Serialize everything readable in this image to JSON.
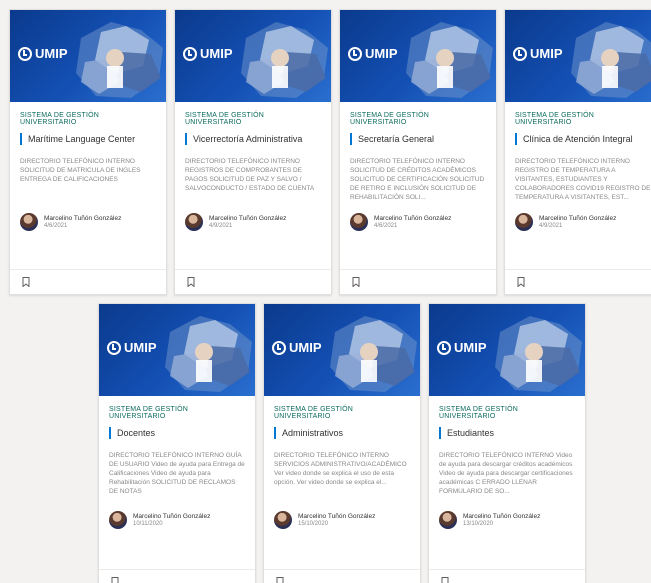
{
  "colors": {
    "banner": "#1450b4",
    "accent": "#0078d4",
    "section": "#0b6a5e",
    "page_bg": "#f3f2f1"
  },
  "icons": {
    "logo": "umip-logo-icon",
    "bookmark": "bookmark-icon",
    "avatar": "avatar-icon"
  },
  "cards": [
    {
      "logo": "UMIP",
      "section": "SISTEMA DE GESTIÓN UNIVERSITARIO",
      "title": "Marítime Language Center",
      "description": "DIRECTORIO TELEFÓNICO INTERNO SOLICITUD DE MATRICULA DE INGLES ENTREGA DE CALIFICACIONES",
      "author": "Marcelino Tuñón González",
      "date": "4/6/2021"
    },
    {
      "logo": "UMIP",
      "section": "SISTEMA DE GESTIÓN UNIVERSITARIO",
      "title": "Vicerrectoría Administrativa",
      "description": "DIRECTORIO TELEFÓNICO INTERNO REGISTROS DE COMPROBANTES DE PAGOS SOLICITUD DE PAZ Y SALVO / SALVOCONDUCTO / ESTADO DE CUENTA",
      "author": "Marcelino Tuñón González",
      "date": "4/9/2021"
    },
    {
      "logo": "UMIP",
      "section": "SISTEMA DE GESTIÓN UNIVERSITARIO",
      "title": "Secretaría General",
      "description": "DIRECTORIO TELEFÓNICO INTERNO SOLICITUD DE CRÉDITOS ACADÉMICOS SOLICITUD DE CERTIFICACIÓN SOLICITUD DE RETIRO E INCLUSIÓN SOLICITUD DE REHABILITACIÓN SOLI...",
      "author": "Marcelino Tuñón González",
      "date": "4/6/2021"
    },
    {
      "logo": "UMIP",
      "section": "SISTEMA DE GESTIÓN UNIVERSITARIO",
      "title": "Clínica de Atención Integral",
      "description": "DIRECTORIO TELEFÓNICO INTERNO REGISTRO DE TEMPERATURA A VISITANTES, ESTUDIANTES Y COLABORADORES COVID19 REGISTRO DE TEMPERATURA A VISITANTES, EST...",
      "author": "Marcelino Tuñón González",
      "date": "4/9/2021"
    },
    {
      "logo": "UMIP",
      "section": "SISTEMA DE GESTIÓN UNIVERSITARIO",
      "title": "Docentes",
      "description": "DIRECTORIO TELEFÓNICO INTERNO GUÍA DE USUARIO Video de ayuda para Entrega de Calificaciones Video de ayuda para Rehabilitación SOLICITUD DE RECLAMOS DE NOTAS",
      "author": "Marcelino Tuñón González",
      "date": "10/11/2020"
    },
    {
      "logo": "UMIP",
      "section": "SISTEMA DE GESTIÓN UNIVERSITARIO",
      "title": "Administrativos",
      "description": "DIRECTORIO TELEFÓNICO INTERNO SERVICIOS ADMINISTRATIVO/ACADÉMICO Ver video donde se explica el uso de esta opción. Ver video donde se explica el...",
      "author": "Marcelino Tuñón González",
      "date": "15/10/2020"
    },
    {
      "logo": "UMIP",
      "section": "SISTEMA DE GESTIÓN UNIVERSITARIO",
      "title": "Estudiantes",
      "description": "DIRECTORIO TELEFÓNICO INTERNO Video de ayuda para descargar créditos académicos Video de ayuda para descargar certificaciones académicas C ERRADO LLENAR FORMULARIO DE SO...",
      "author": "Marcelino Tuñón González",
      "date": "13/10/2020"
    }
  ]
}
